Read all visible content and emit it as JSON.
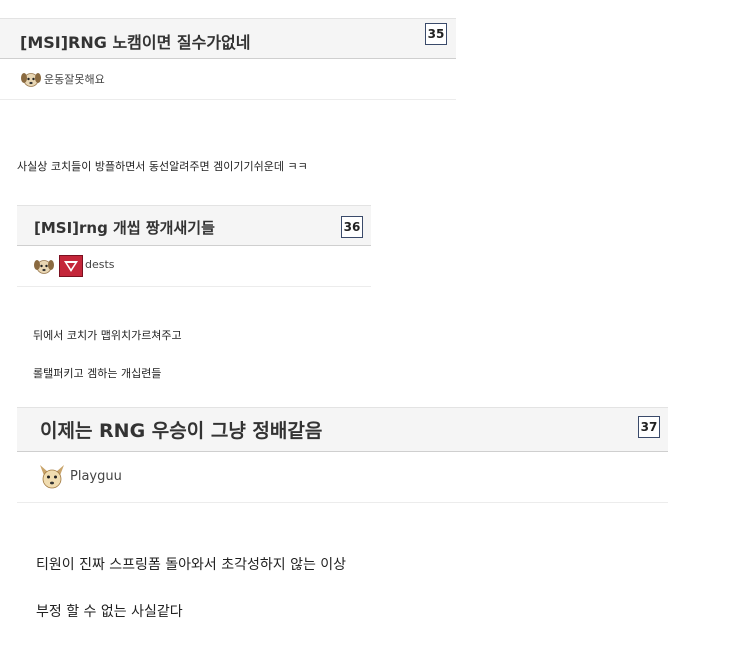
{
  "posts": [
    {
      "title": "[MSI]RNG 노캠이면 질수가없네",
      "number": "35",
      "author": "운동잘못해요",
      "lines": [
        "사실상 코치들이 방플하면서 동선알려주면 겜이기기쉬운데 ㅋㅋ"
      ]
    },
    {
      "title": "[MSI]rng 개씹 짱개새기들",
      "number": "36",
      "author": "dests",
      "lines": [
        "뒤에서 코치가 맵위치가르쳐주고",
        "롤탤퍼키고 겜하는 개십련들"
      ]
    },
    {
      "title": "이제는 RNG 우승이 그냥 정배같음",
      "number": "37",
      "author": "Playguu",
      "lines": [
        "티원이 진짜 스프링폼 돌아와서 초각성하지 않는 이상",
        "부정 할 수 없는 사실같다"
      ]
    }
  ],
  "icons": {
    "dog": "dog-face-icon",
    "team_badge": "team-logo-icon"
  },
  "colors": {
    "header_bg": "#f5f5f5",
    "number_border": "#3a4a6a",
    "badge_red": "#c4263a"
  }
}
